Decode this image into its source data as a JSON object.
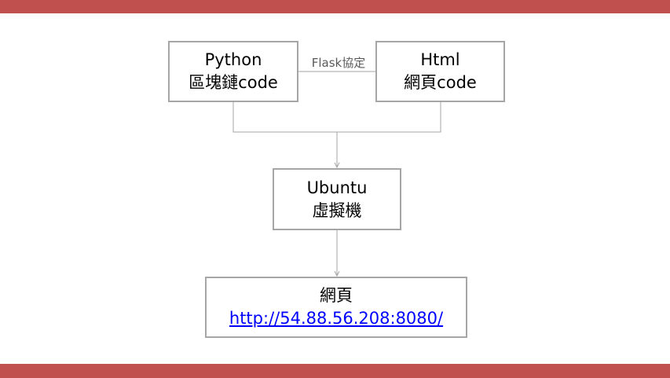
{
  "colors": {
    "band": "#c0504d",
    "line": "#a6a6a6",
    "label": "#595959",
    "link": "#0000ff"
  },
  "nodes": {
    "python": {
      "line1": "Python",
      "line2": "區塊鏈code"
    },
    "html": {
      "line1": "Html",
      "line2": "網頁code"
    },
    "ubuntu": {
      "line1": "Ubuntu",
      "line2": "虛擬機"
    },
    "web": {
      "line1": "網頁",
      "url": "http://54.88.56.208:8080/"
    }
  },
  "edges": {
    "python_html_label": "Flask協定"
  }
}
